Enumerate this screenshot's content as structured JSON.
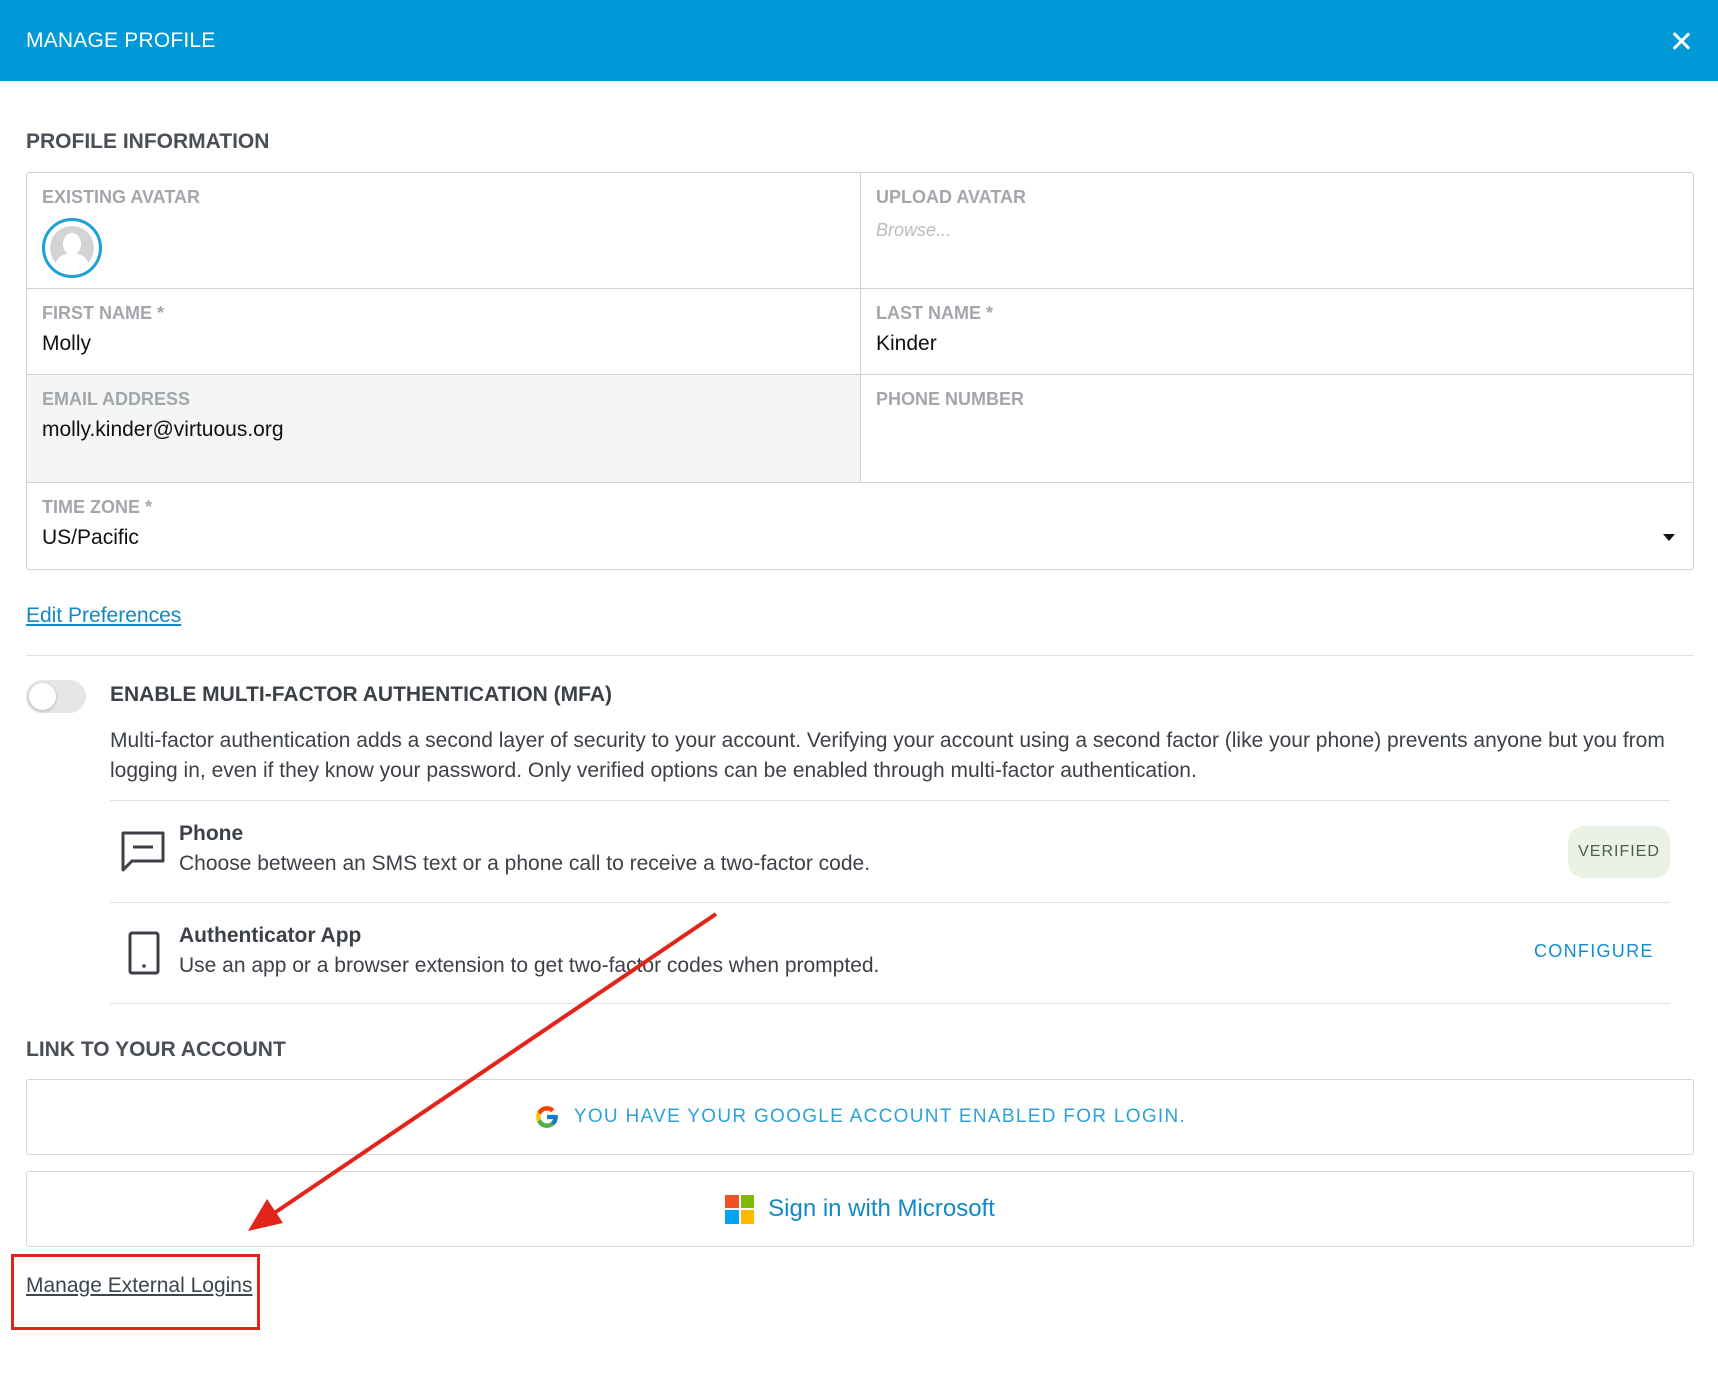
{
  "header": {
    "title": "MANAGE PROFILE"
  },
  "profile": {
    "section_title": "PROFILE INFORMATION",
    "existing_avatar_label": "EXISTING AVATAR",
    "upload_avatar_label": "UPLOAD AVATAR",
    "upload_placeholder": "Browse...",
    "first_name_label": "FIRST NAME *",
    "first_name": "Molly",
    "last_name_label": "LAST NAME *",
    "last_name": "Kinder",
    "email_label": "EMAIL ADDRESS",
    "email": "molly.kinder@virtuous.org",
    "phone_label": "PHONE NUMBER",
    "phone": "",
    "timezone_label": "TIME ZONE *",
    "timezone": "US/Pacific",
    "edit_preferences": "Edit Preferences"
  },
  "mfa": {
    "title": "ENABLE MULTI-FACTOR AUTHENTICATION (MFA)",
    "enabled": false,
    "description": "Multi-factor authentication adds a second layer of security to your account. Verifying your account using a second factor (like your phone) prevents anyone but you from logging in, even if they know your password. Only verified options can be enabled through multi-factor authentication.",
    "methods": [
      {
        "name": "Phone",
        "description": "Choose between an SMS text or a phone call to receive a two-factor code.",
        "status": "VERIFIED",
        "icon": "message-icon"
      },
      {
        "name": "Authenticator App",
        "description": "Use an app or a browser extension to get two-factor codes when prompted.",
        "action": "CONFIGURE",
        "icon": "mobile-device-icon"
      }
    ]
  },
  "link_account": {
    "section_title": "LINK TO YOUR ACCOUNT",
    "google_text": "YOU HAVE YOUR GOOGLE ACCOUNT ENABLED FOR LOGIN.",
    "microsoft_text": "Sign in with Microsoft",
    "manage_external": "Manage External Logins"
  },
  "colors": {
    "header": "#0099d8",
    "link": "#1289c7",
    "annotation": "#e3241b",
    "verified_bg": "#e9f2e4"
  }
}
